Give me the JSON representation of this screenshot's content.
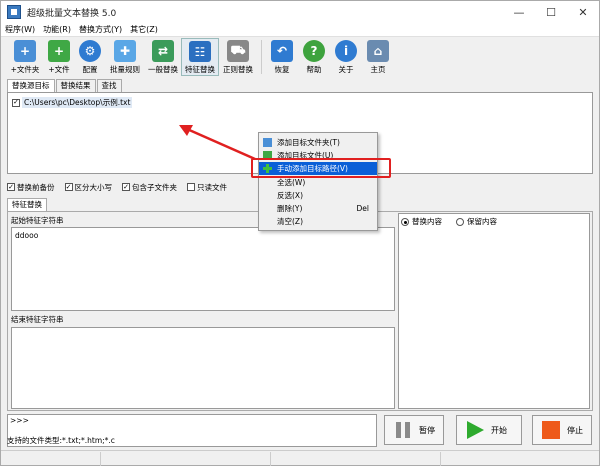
{
  "window": {
    "title": "超级批量文本替换 5.0",
    "min_glyph": "—",
    "max_glyph": "☐",
    "close_glyph": "✕"
  },
  "menu": [
    "程序(W)",
    "功能(R)",
    "替换方式(Y)",
    "其它(Z)"
  ],
  "toolbar": [
    {
      "label": "+文件夹",
      "icon": "folder-add-icon",
      "color": "#4a8fd6"
    },
    {
      "label": "+文件",
      "icon": "file-add-icon",
      "color": "#3fa845"
    },
    {
      "label": "配置",
      "icon": "gear-icon",
      "color": "#2f7bd1"
    },
    {
      "label": "批量规则",
      "icon": "puzzle-icon",
      "color": "#5aa7e6"
    },
    {
      "label": "一般替换",
      "icon": "swap-icon",
      "color": "#3b9b5a"
    },
    {
      "label": "特征替换",
      "icon": "tree-icon",
      "color": "#2b6fc0"
    },
    {
      "label": "正则替换",
      "icon": "cart-icon",
      "color": "#888888"
    },
    {
      "label": "恢复",
      "icon": "undo-icon",
      "color": "#2f7bd1"
    },
    {
      "label": "帮助",
      "icon": "help-icon",
      "color": "#3ea33e"
    },
    {
      "label": "关于",
      "icon": "info-icon",
      "color": "#2f7bd1"
    },
    {
      "label": "主页",
      "icon": "home-icon",
      "color": "#6a8bb0"
    }
  ],
  "top_tabs": [
    "替换源目标",
    "替换结果",
    "查找"
  ],
  "source_list": [
    {
      "checked": true,
      "path": "C:\\Users\\pc\\Desktop\\示例.txt"
    }
  ],
  "options": [
    {
      "label": "替换前备份",
      "checked": true
    },
    {
      "label": "区分大小写",
      "checked": true
    },
    {
      "label": "包含子文件夹",
      "checked": true
    },
    {
      "label": "只读文件",
      "checked": false
    }
  ],
  "feature_tab": "特征替换",
  "start_label": "起始特征字符串",
  "start_value": "ddooo",
  "end_label": "结束特征字符串",
  "radios": [
    {
      "label": "替换内容",
      "selected": true
    },
    {
      "label": "保留内容",
      "selected": false
    }
  ],
  "log_prompt": ">>>",
  "status_text": "支持的文件类型:*.txt;*.htm;*.c",
  "buttons": {
    "pause": "暂停",
    "start": "开始",
    "stop": "停止"
  },
  "context_menu": [
    {
      "label": "添加目标文件夹(T)",
      "shortcut": ""
    },
    {
      "label": "添加目标文件(U)",
      "shortcut": ""
    },
    {
      "label": "手动添加目标路径(V)",
      "shortcut": "",
      "highlighted": true
    },
    {
      "label": "全选(W)",
      "shortcut": ""
    },
    {
      "label": "反选(X)",
      "shortcut": ""
    },
    {
      "label": "删除(Y)",
      "shortcut": "Del"
    },
    {
      "label": "清空(Z)",
      "shortcut": ""
    }
  ],
  "colors": {
    "highlight": "#0a5fd7",
    "annotation": "#e02020"
  }
}
